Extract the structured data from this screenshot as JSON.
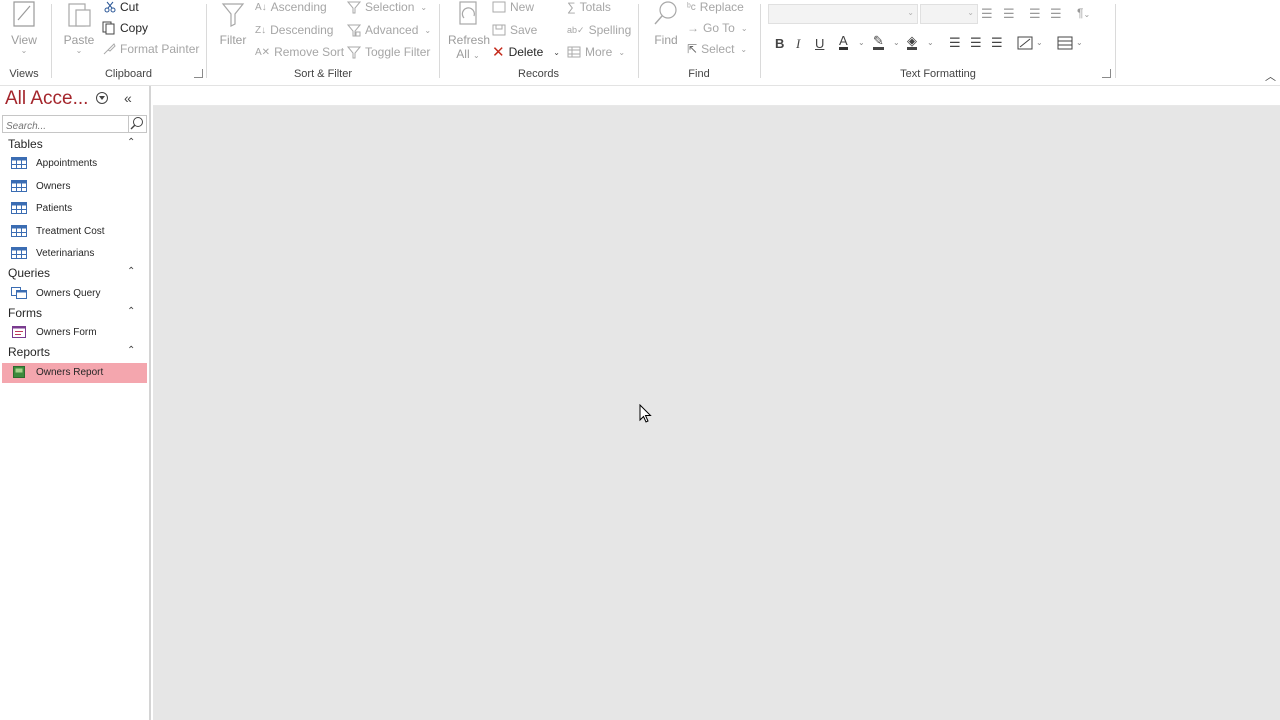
{
  "ribbon": {
    "views": {
      "view_label": "View",
      "group_label": "Views"
    },
    "clipboard": {
      "paste_label": "Paste",
      "cut_label": "Cut",
      "copy_label": "Copy",
      "format_painter_label": "Format Painter",
      "group_label": "Clipboard"
    },
    "sort_filter": {
      "filter_label": "Filter",
      "ascending_label": "Ascending",
      "descending_label": "Descending",
      "remove_sort_label": "Remove Sort",
      "selection_label": "Selection",
      "advanced_label": "Advanced",
      "toggle_filter_label": "Toggle Filter",
      "group_label": "Sort & Filter"
    },
    "records": {
      "refresh_label": "Refresh",
      "refresh_sub": "All",
      "new_label": "New",
      "save_label": "Save",
      "delete_label": "Delete",
      "totals_label": "Totals",
      "spelling_label": "Spelling",
      "more_label": "More",
      "group_label": "Records"
    },
    "find": {
      "find_label": "Find",
      "replace_label": "Replace",
      "goto_label": "Go To",
      "select_label": "Select",
      "group_label": "Find"
    },
    "text_formatting": {
      "bold": "B",
      "italic": "I",
      "underline": "U",
      "font_color_glyph": "A",
      "group_label": "Text Formatting"
    }
  },
  "nav": {
    "title": "All Acce...",
    "search_placeholder": "Search...",
    "sections": [
      {
        "title": "Tables",
        "items": [
          "Appointments",
          "Owners",
          "Patients",
          "Treatment Cost",
          "Veterinarians"
        ]
      },
      {
        "title": "Queries",
        "items": [
          "Owners Query"
        ]
      },
      {
        "title": "Forms",
        "items": [
          "Owners Form"
        ]
      },
      {
        "title": "Reports",
        "items": [
          "Owners Report"
        ]
      }
    ],
    "selected_item": "Owners Report"
  },
  "colors": {
    "accent": "#a4262c",
    "selected_bg": "#f4a6ae",
    "workspace_bg": "#e6e6e6"
  }
}
